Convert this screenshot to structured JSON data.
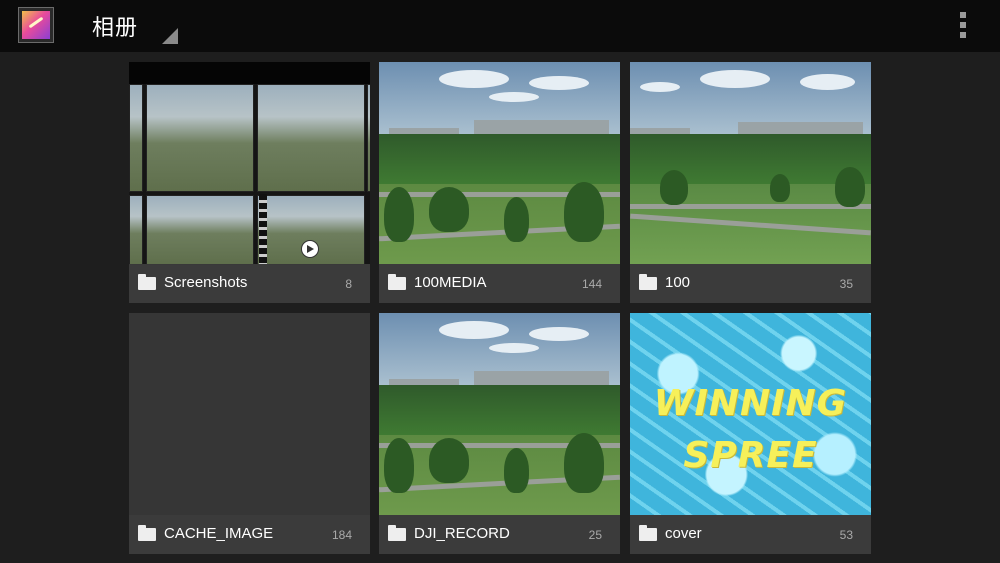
{
  "app": {
    "title": "相册"
  },
  "albums": [
    {
      "name": "Screenshots",
      "count": "8"
    },
    {
      "name": "100MEDIA",
      "count": "144"
    },
    {
      "name": "100",
      "count": "35"
    },
    {
      "name": "CACHE_IMAGE",
      "count": "184"
    },
    {
      "name": "DJI_RECORD",
      "count": "25"
    },
    {
      "name": "cover",
      "count": "53"
    }
  ],
  "cover_thumbnail": {
    "line1": "WINNING",
    "line2": "SPREE"
  },
  "colors": {
    "bar": "#0b0b0b",
    "background": "#1e1e1e",
    "caption": "#3c3c3c",
    "cover_text": "#f6f05a"
  }
}
